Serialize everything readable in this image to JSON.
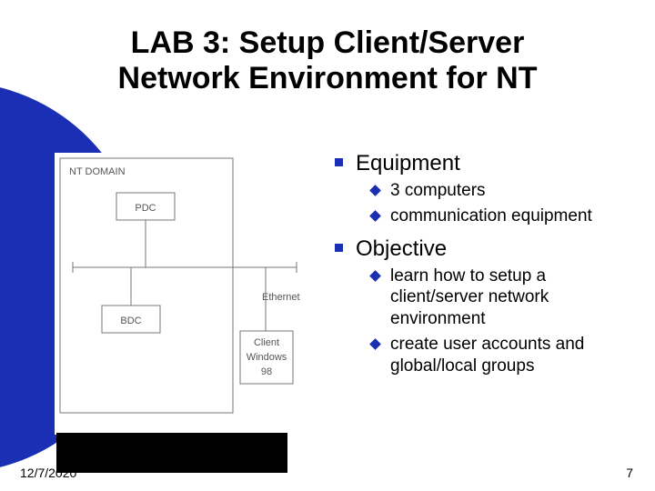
{
  "title_line1": "LAB 3: Setup Client/Server",
  "title_line2": "Network Environment for NT",
  "diagram": {
    "domain_label": "NT DOMAIN",
    "pdc": "PDC",
    "bdc": "BDC",
    "ethernet": "Ethernet",
    "client_l1": "Client",
    "client_l2": "Windows",
    "client_l3": "98"
  },
  "sections": [
    {
      "heading": "Equipment",
      "items": [
        "3 computers",
        "communication equipment"
      ]
    },
    {
      "heading": "Objective",
      "items": [
        "learn how to setup a client/server network environment",
        "create user accounts and global/local groups"
      ]
    }
  ],
  "footer": {
    "date": "12/7/2020",
    "page": "7"
  }
}
